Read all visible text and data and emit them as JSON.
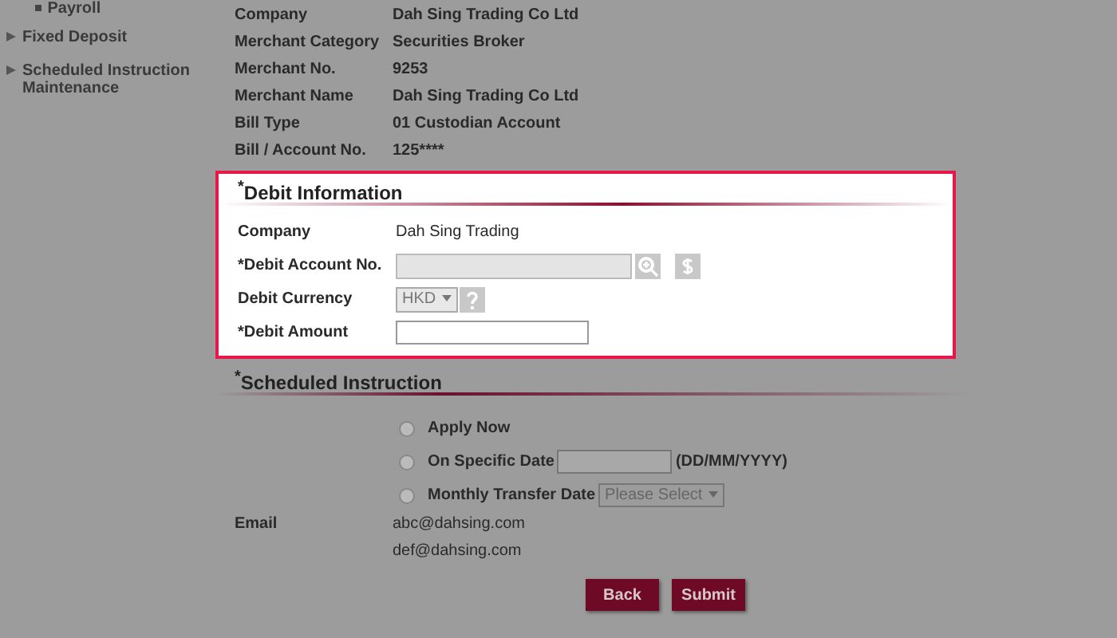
{
  "sidebar": {
    "items": [
      {
        "label": "Payroll",
        "kind": "sub"
      },
      {
        "label": "Fixed Deposit",
        "kind": "main"
      },
      {
        "label": "Scheduled Instruction Maintenance",
        "kind": "main"
      }
    ]
  },
  "details": [
    {
      "label": "Company",
      "value": "Dah Sing Trading Co Ltd"
    },
    {
      "label": "Merchant Category",
      "value": "Securities Broker"
    },
    {
      "label": "Merchant No.",
      "value": "9253"
    },
    {
      "label": "Merchant Name",
      "value": "Dah Sing Trading Co Ltd"
    },
    {
      "label": "Bill Type",
      "value": "01 Custodian Account"
    },
    {
      "label": "Bill / Account No.",
      "value": "125****"
    }
  ],
  "debit": {
    "title": "$^{*}$Debit Information",
    "company_label": "Company",
    "company": "Dah Sing Trading",
    "account_label": "*Debit Account No.",
    "account_disabled": true,
    "currency_label": "Debit Currency",
    "currency": "HKD",
    "amount_label": "*Debit Amount"
  },
  "schedule": {
    "title": "$^{*}$Scheduled Instruction",
    "options": [
      {
        "label": "Apply Now",
        "kind": "plain",
        "selected": false
      },
      {
        "label": "On Specific Date",
        "kind": "date",
        "selected": false,
        "hint": "(DD/MM/YYYY)"
      },
      {
        "label": "Monthly Transfer Date",
        "kind": "select",
        "selected": false,
        "select": "Please Select"
      }
    ]
  },
  "email": {
    "label": "Email",
    "values": [
      "abc@dahsing.com",
      "def@dahsing.com"
    ]
  },
  "buttons": [
    "Back",
    "Submit"
  ]
}
